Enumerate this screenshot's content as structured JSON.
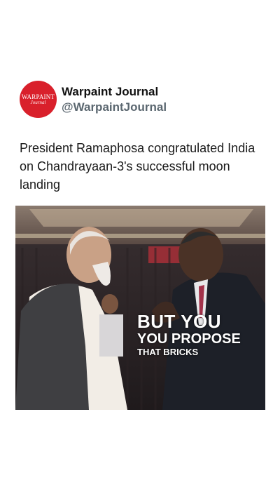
{
  "post": {
    "account_name": "Warpaint Journal",
    "account_handle": "@WarpaintJournal",
    "avatar_logo_text": "WARPAINT",
    "avatar_logo_sub": "Journal",
    "caption": "President Ramaphosa congratulated India on Chandrayaan-3's successful moon landing"
  },
  "video": {
    "subtitle_line1": "BUT YOU",
    "subtitle_line2": "YOU PROPOSE",
    "subtitle_line3": "THAT BRICKS"
  },
  "colors": {
    "avatar_red": "#d9202b",
    "handle_gray": "#5b6770"
  }
}
